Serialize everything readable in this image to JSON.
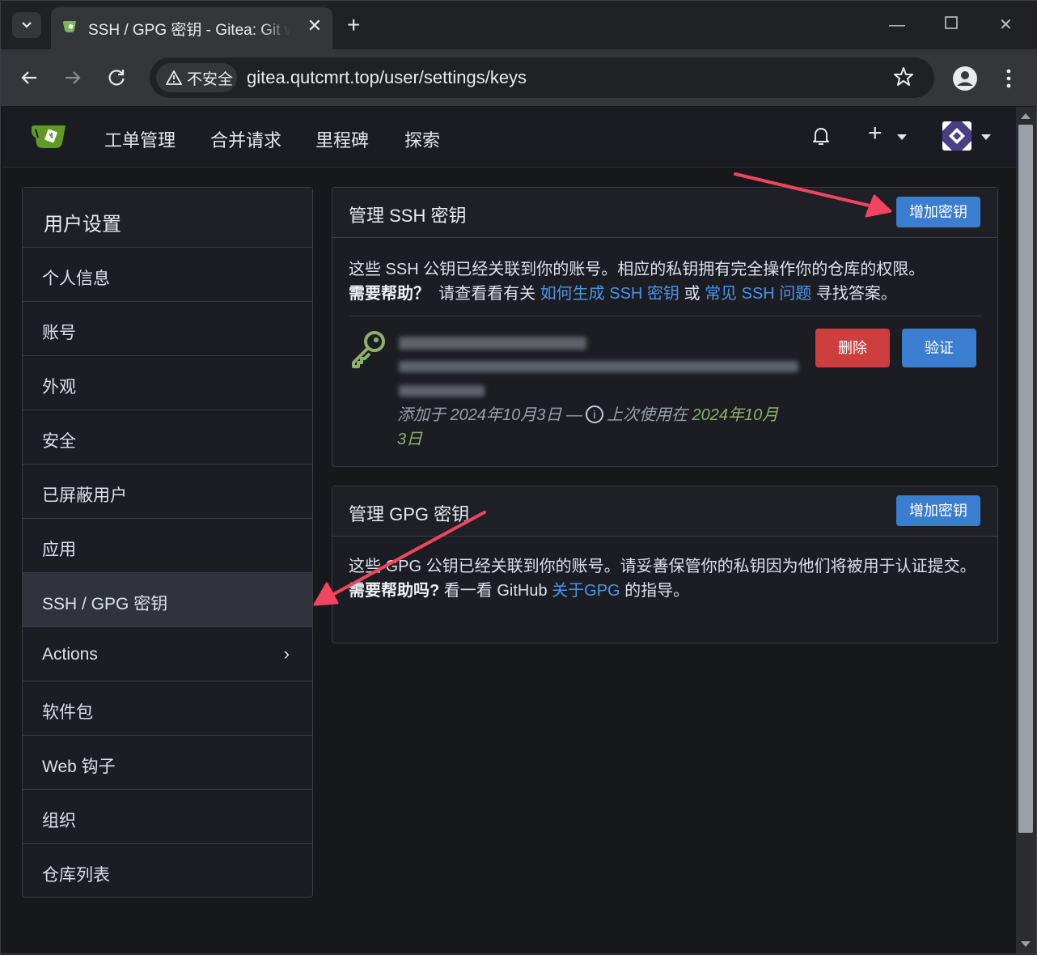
{
  "browser": {
    "tab_title": "SSH / GPG 密钥 - Gitea: Git w",
    "security_label": "不安全",
    "url": "gitea.qutcmrt.top/user/settings/keys"
  },
  "nav": {
    "items": [
      "工单管理",
      "合并请求",
      "里程碑",
      "探索"
    ]
  },
  "sidebar": {
    "title": "用户设置",
    "items": [
      {
        "label": "个人信息"
      },
      {
        "label": "账号"
      },
      {
        "label": "外观"
      },
      {
        "label": "安全"
      },
      {
        "label": "已屏蔽用户"
      },
      {
        "label": "应用"
      },
      {
        "label": "SSH / GPG 密钥",
        "active": true
      },
      {
        "label": "Actions",
        "chevron": "›"
      },
      {
        "label": "软件包"
      },
      {
        "label": "Web 钩子"
      },
      {
        "label": "组织"
      },
      {
        "label": "仓库列表"
      }
    ]
  },
  "ssh": {
    "title": "管理 SSH 密钥",
    "add_button": "增加密钥",
    "desc": "这些 SSH 公钥已经关联到你的账号。相应的私钥拥有完全操作你的仓库的权限。",
    "help_label": "需要帮助？",
    "help_text_1": "请查看看有关",
    "help_link_1": "如何生成 SSH 密钥",
    "help_or": "或",
    "help_link_2": "常见 SSH 问题",
    "help_text_2": "寻找答案。",
    "key": {
      "added_prefix": "添加于 2024年10月3日 —",
      "info_glyph": "i",
      "last_used_prefix": "上次使用在",
      "last_used_date_1": "2024年10月",
      "last_used_date_2": "3日",
      "delete_button": "删除",
      "verify_button": "验证"
    }
  },
  "gpg": {
    "title": "管理 GPG 密钥",
    "add_button": "增加密钥",
    "desc": "这些 GPG 公钥已经关联到你的账号。请妥善保管你的私钥因为他们将被用于认证提交。",
    "help_label": "需要帮助吗?",
    "help_text_1": "看一看 GitHub",
    "help_link": "关于GPG",
    "help_text_2": "的指导。"
  },
  "colors": {
    "accent_blue": "#3b7dcf",
    "danger_red": "#cf3e3e",
    "link_blue": "#4c94e8",
    "annotation_arrow": "#f0445f",
    "gitea_green": "#609926"
  }
}
